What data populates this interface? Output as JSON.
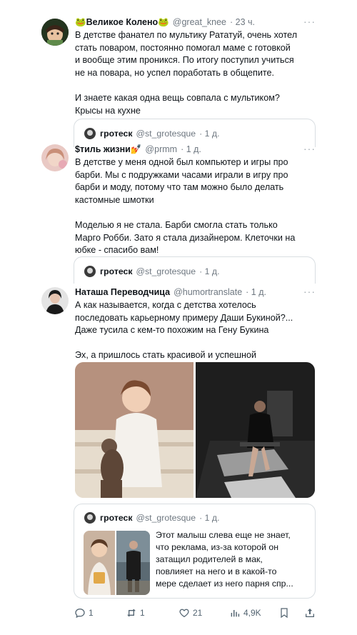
{
  "tweets": [
    {
      "name": "🐸Великое Колено🐸",
      "handle": "@great_knee",
      "time": "· 23 ч.",
      "lines": [
        "В детстве фанател по мультику Рататуй, очень хотел",
        "стать поваром, постоянно помогал маме с готовкой",
        "и вообще этим проникся. По итогу поступил учиться",
        "не на повара, но успел поработать в общепите.",
        "",
        "И знаете какая одна вещь совпала с мультиком?",
        "Крысы на кухне"
      ]
    },
    {
      "name": "$тиль жизни💅",
      "handle": "@prmm",
      "time": "· 1 д.",
      "lines": [
        "В детстве у меня одной был компьютер и игры про",
        "барби. Мы с подружками часами играли в игру про",
        "барби и моду, потому что там можно было делать",
        "кастомные шмотки",
        "",
        "Моделью я не стала. Барби смогла стать только",
        "Марго Робби. Зато я стала дизайнером. Клеточки на",
        "юбке - спасибо вам!"
      ]
    },
    {
      "name": "Наташа Переводчица",
      "handle": "@humortranslate",
      "time": "· 1 д.",
      "lines": [
        "А как называется, когда с детства хотелось",
        "последовать карьерному примеру Даши Букиной?...",
        "Даже тусила с кем-то похожим на Гену Букина",
        "",
        "Эх, а пришлось стать красивой и успешной"
      ]
    }
  ],
  "quote": {
    "name": "гротеск",
    "handle": "@st_grotesque",
    "time": "· 1 д.",
    "last_lines": [
      "Этот малыш слева  еще не знает,",
      "что реклама, из-за которой он",
      "затащил родителей в мак,",
      "повлияет на него и в какой-то",
      "мере сделает из него парня спр..."
    ]
  },
  "more_label": "···",
  "actions": {
    "replies": "1",
    "retweets": "1",
    "likes": "21",
    "views": "4,9K"
  }
}
